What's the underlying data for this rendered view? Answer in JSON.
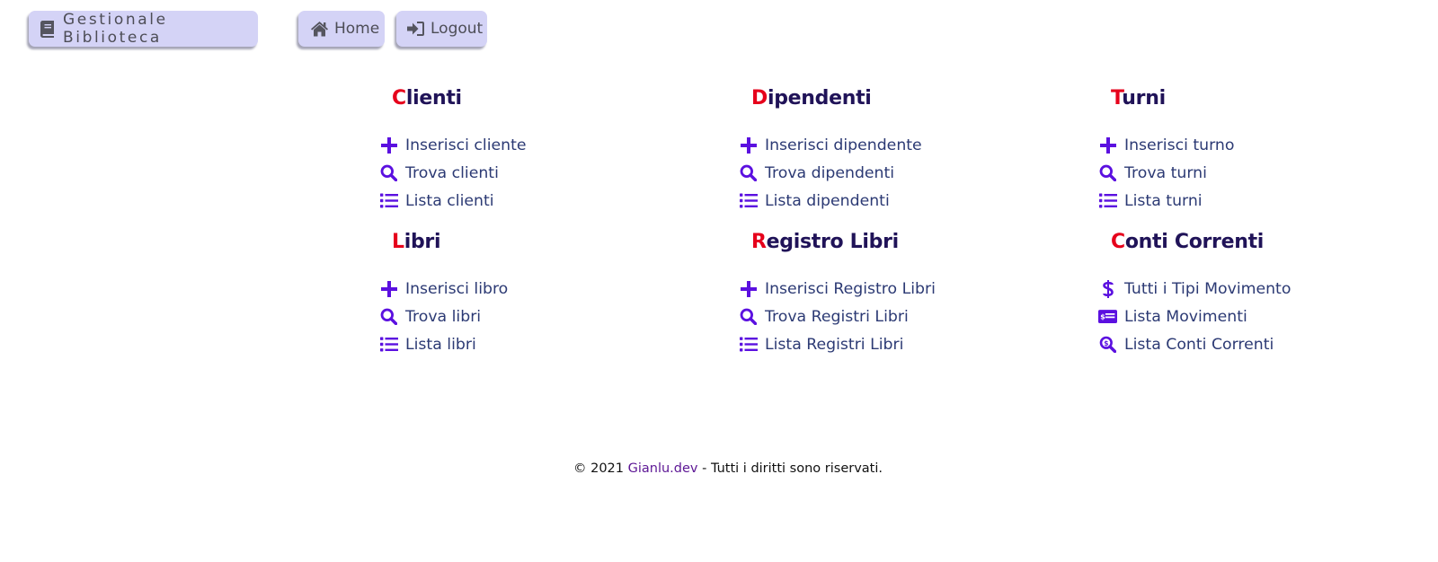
{
  "header": {
    "brand_label": "Gestionale Biblioteca",
    "home_label": "Home",
    "logout_label": "Logout"
  },
  "sections": {
    "clienti": {
      "title_first": "C",
      "title_rest": "lienti",
      "items": [
        {
          "icon": "plus-icon",
          "label": "Inserisci cliente"
        },
        {
          "icon": "search-icon",
          "label": "Trova clienti"
        },
        {
          "icon": "list-icon",
          "label": "Lista clienti"
        }
      ]
    },
    "dipendenti": {
      "title_first": "D",
      "title_rest": "ipendenti",
      "items": [
        {
          "icon": "plus-icon",
          "label": "Inserisci dipendente"
        },
        {
          "icon": "search-icon",
          "label": "Trova dipendenti"
        },
        {
          "icon": "list-icon",
          "label": "Lista dipendenti"
        }
      ]
    },
    "turni": {
      "title_first": "T",
      "title_rest": "urni",
      "items": [
        {
          "icon": "plus-icon",
          "label": "Inserisci turno"
        },
        {
          "icon": "search-icon",
          "label": "Trova turni"
        },
        {
          "icon": "list-icon",
          "label": "Lista turni"
        }
      ]
    },
    "libri": {
      "title_first": "L",
      "title_rest": "ibri",
      "items": [
        {
          "icon": "plus-icon",
          "label": "Inserisci libro"
        },
        {
          "icon": "search-icon",
          "label": "Trova libri"
        },
        {
          "icon": "list-icon",
          "label": "Lista libri"
        }
      ]
    },
    "registro_libri": {
      "title_first": "R",
      "title_rest": "egistro Libri",
      "items": [
        {
          "icon": "plus-icon",
          "label": "Inserisci Registro Libri"
        },
        {
          "icon": "search-icon",
          "label": "Trova Registri Libri"
        },
        {
          "icon": "list-icon",
          "label": "Lista Registri Libri"
        }
      ]
    },
    "conti_correnti": {
      "title_first": "C",
      "title_rest": "onti Correnti",
      "items": [
        {
          "icon": "dollar-icon",
          "label": "Tutti i Tipi Movimento"
        },
        {
          "icon": "money-check-icon",
          "label": "Lista Movimenti"
        },
        {
          "icon": "search-dollar-icon",
          "label": "Lista Conti Correnti"
        }
      ]
    }
  },
  "footer": {
    "prefix": "© 2021",
    "link_label": "Gianlu.dev",
    "suffix": "- Tutti i diritti sono riservati."
  },
  "colors": {
    "accent_red": "#e6001b",
    "title_navy": "#201358",
    "icon_purple": "#5b10e0",
    "link_text": "#2c3a74",
    "nav_button_bg": "#d4d3f6",
    "footer_link": "#5d1795"
  }
}
